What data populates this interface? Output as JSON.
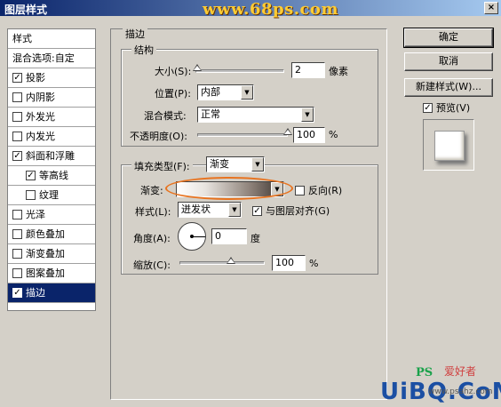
{
  "window": {
    "title": "图层样式",
    "watermark": "www.68ps.com",
    "close_glyph": "×"
  },
  "style_list": [
    {
      "label": "样式",
      "checkbox": false,
      "checked": false,
      "indent": false,
      "selected": false
    },
    {
      "label": "混合选项:自定",
      "checkbox": false,
      "checked": false,
      "indent": false,
      "selected": false
    },
    {
      "label": "投影",
      "checkbox": true,
      "checked": true,
      "indent": false,
      "selected": false
    },
    {
      "label": "内阴影",
      "checkbox": true,
      "checked": false,
      "indent": false,
      "selected": false
    },
    {
      "label": "外发光",
      "checkbox": true,
      "checked": false,
      "indent": false,
      "selected": false
    },
    {
      "label": "内发光",
      "checkbox": true,
      "checked": false,
      "indent": false,
      "selected": false
    },
    {
      "label": "斜面和浮雕",
      "checkbox": true,
      "checked": true,
      "indent": false,
      "selected": false
    },
    {
      "label": "等高线",
      "checkbox": true,
      "checked": true,
      "indent": true,
      "selected": false
    },
    {
      "label": "纹理",
      "checkbox": true,
      "checked": false,
      "indent": true,
      "selected": false
    },
    {
      "label": "光泽",
      "checkbox": true,
      "checked": false,
      "indent": false,
      "selected": false
    },
    {
      "label": "颜色叠加",
      "checkbox": true,
      "checked": false,
      "indent": false,
      "selected": false
    },
    {
      "label": "渐变叠加",
      "checkbox": true,
      "checked": false,
      "indent": false,
      "selected": false
    },
    {
      "label": "图案叠加",
      "checkbox": true,
      "checked": false,
      "indent": false,
      "selected": false
    },
    {
      "label": "描边",
      "checkbox": true,
      "checked": true,
      "indent": false,
      "selected": true
    }
  ],
  "stroke": {
    "section_title": "描边",
    "structure": {
      "title": "结构",
      "size_label": "大小(S):",
      "size_value": "2",
      "size_unit": "像素",
      "size_slider": 0.02,
      "position_label": "位置(P):",
      "position_value": "内部",
      "blend_label": "混合模式:",
      "blend_value": "正常",
      "opacity_label": "不透明度(O):",
      "opacity_value": "100",
      "opacity_unit": "%",
      "opacity_slider": 1.0
    },
    "fill": {
      "type_label": "填充类型(F):",
      "type_value": "渐变",
      "gradient_label": "渐变:",
      "reverse_label": "反向(R)",
      "reverse_checked": false,
      "style_label": "样式(L):",
      "style_value": "迸发状",
      "align_label": "与图层对齐(G)",
      "align_checked": true,
      "angle_label": "角度(A):",
      "angle_value": "0",
      "angle_unit": "度",
      "scale_label": "缩放(C):",
      "scale_value": "100",
      "scale_unit": "%",
      "scale_slider": 0.6
    }
  },
  "buttons": {
    "ok": "确定",
    "cancel": "取消",
    "new_style": "新建样式(W)...",
    "preview_label": "预览(V)",
    "preview_checked": true
  },
  "corner_logo": {
    "ps": "PS",
    "hao": "爱好者",
    "brand": "UiBQ.CoM",
    "site": "www.psahz.com"
  },
  "check_glyph": "✓",
  "arrow_glyph": "▼"
}
